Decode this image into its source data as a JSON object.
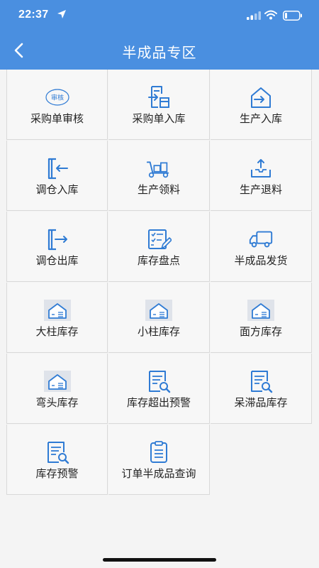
{
  "status_bar": {
    "time": "22:37"
  },
  "header": {
    "title": "半成品专区"
  },
  "colors": {
    "header_bg": "#4a8fe0",
    "icon": "#2f7bd4",
    "thumb_bg": "#dfe3ea"
  },
  "grid": {
    "items": [
      {
        "label": "采购单审核",
        "icon": "audit-stamp-icon",
        "badge": "审核"
      },
      {
        "label": "采购单入库",
        "icon": "document-inbound-icon"
      },
      {
        "label": "生产入库",
        "icon": "warehouse-in-icon"
      },
      {
        "label": "调仓入库",
        "icon": "door-enter-icon"
      },
      {
        "label": "生产领料",
        "icon": "hand-truck-icon"
      },
      {
        "label": "生产退料",
        "icon": "tray-upload-icon"
      },
      {
        "label": "调仓出库",
        "icon": "door-exit-icon"
      },
      {
        "label": "库存盘点",
        "icon": "checklist-edit-icon"
      },
      {
        "label": "半成品发货",
        "icon": "delivery-truck-icon"
      },
      {
        "label": "大柱库存",
        "icon": "warehouse-thumb-icon"
      },
      {
        "label": "小柱库存",
        "icon": "warehouse-thumb-icon"
      },
      {
        "label": "面方库存",
        "icon": "warehouse-thumb-icon"
      },
      {
        "label": "弯头库存",
        "icon": "warehouse-thumb-icon"
      },
      {
        "label": "库存超出预警",
        "icon": "report-search-icon"
      },
      {
        "label": "呆滞品库存",
        "icon": "report-search-icon"
      },
      {
        "label": "库存预警",
        "icon": "report-search-icon"
      },
      {
        "label": "订单半成品查询",
        "icon": "clipboard-list-icon"
      }
    ]
  }
}
